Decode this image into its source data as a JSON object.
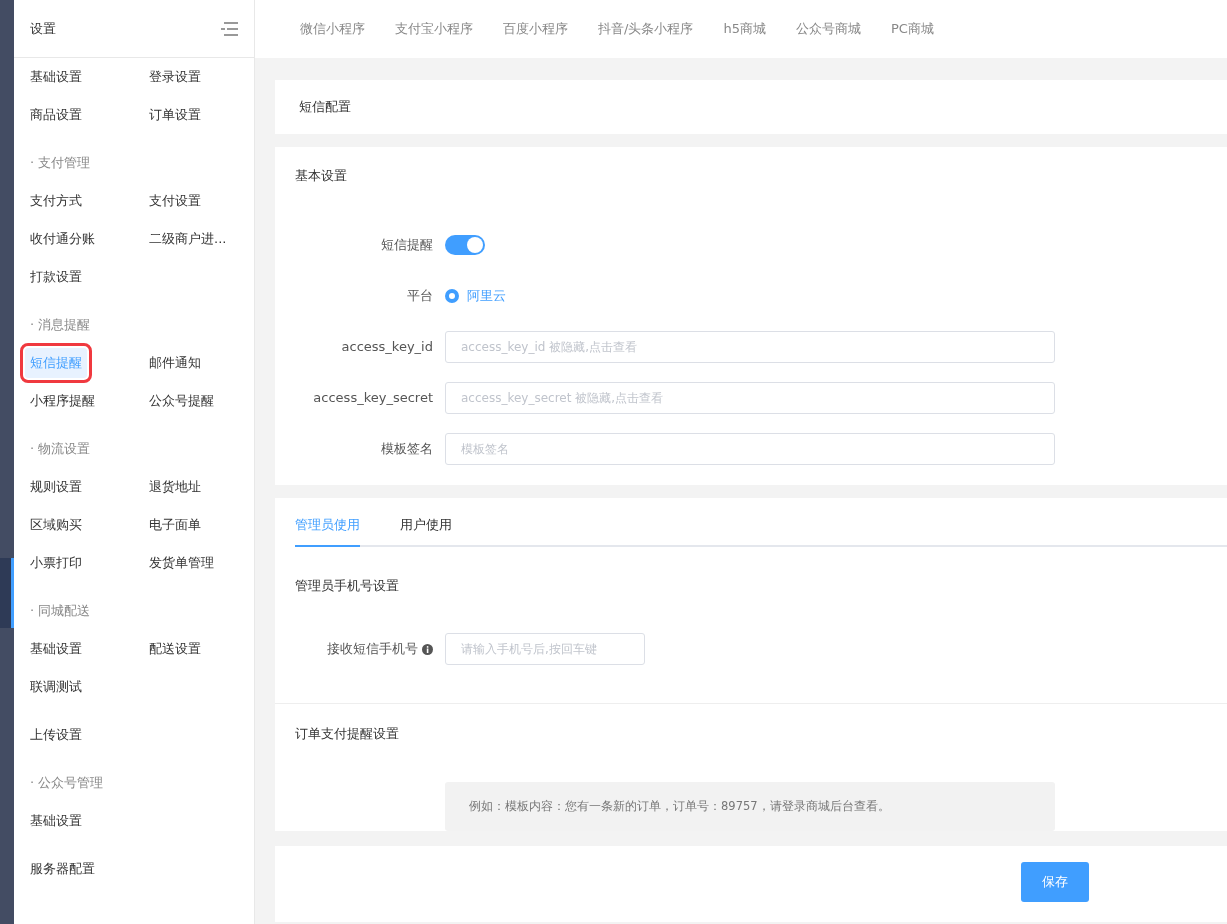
{
  "sidebar": {
    "title": "设置",
    "groups": [
      {
        "items": [
          {
            "label": "基础设置",
            "selected": false
          },
          {
            "label": "登录设置",
            "selected": false
          },
          {
            "label": "商品设置",
            "selected": false
          },
          {
            "label": "订单设置",
            "selected": false
          }
        ]
      },
      {
        "heading": "· 支付管理",
        "items": [
          {
            "label": "支付方式",
            "selected": false
          },
          {
            "label": "支付设置",
            "selected": false
          },
          {
            "label": "收付通分账",
            "selected": false
          },
          {
            "label": "二级商户进...",
            "selected": false
          },
          {
            "label": "打款设置",
            "selected": false
          }
        ]
      },
      {
        "heading": "· 消息提醒",
        "items": [
          {
            "label": "短信提醒",
            "selected": true
          },
          {
            "label": "邮件通知",
            "selected": false
          },
          {
            "label": "小程序提醒",
            "selected": false
          },
          {
            "label": "公众号提醒",
            "selected": false
          }
        ]
      },
      {
        "heading": "· 物流设置",
        "items": [
          {
            "label": "规则设置",
            "selected": false
          },
          {
            "label": "退货地址",
            "selected": false
          },
          {
            "label": "区域购买",
            "selected": false
          },
          {
            "label": "电子面单",
            "selected": false
          },
          {
            "label": "小票打印",
            "selected": false
          },
          {
            "label": "发货单管理",
            "selected": false
          }
        ]
      },
      {
        "heading": "· 同城配送",
        "items": [
          {
            "label": "基础设置",
            "selected": false
          },
          {
            "label": "配送设置",
            "selected": false
          },
          {
            "label": "联调测试",
            "selected": false
          }
        ]
      },
      {
        "items": [
          {
            "label": "上传设置",
            "selected": false
          }
        ]
      },
      {
        "heading": "· 公众号管理",
        "items": [
          {
            "label": "基础设置",
            "selected": false
          }
        ]
      },
      {
        "items": [
          {
            "label": "服务器配置",
            "selected": false
          }
        ]
      }
    ]
  },
  "top_tabs": [
    "微信小程序",
    "支付宝小程序",
    "百度小程序",
    "抖音/头条小程序",
    "h5商城",
    "公众号商城",
    "PC商城"
  ],
  "page_title": "短信配置",
  "basic": {
    "title": "基本设置",
    "fields": [
      {
        "kind": "switch",
        "label": "短信提醒",
        "on": true
      },
      {
        "kind": "radio",
        "label": "平台",
        "options": [
          {
            "label": "阿里云",
            "selected": true
          }
        ]
      },
      {
        "kind": "input",
        "label": "access_key_id",
        "placeholder": "access_key_id 被隐藏,点击查看"
      },
      {
        "kind": "input",
        "label": "access_key_secret",
        "placeholder": "access_key_secret 被隐藏,点击查看"
      },
      {
        "kind": "input",
        "label": "模板签名",
        "placeholder": "模板签名"
      }
    ]
  },
  "usage_tabs": [
    {
      "label": "管理员使用",
      "selected": true
    },
    {
      "label": "用户使用",
      "selected": false
    }
  ],
  "admin_phone": {
    "title": "管理员手机号设置",
    "label": "接收短信手机号",
    "placeholder": "请输入手机号后,按回车键"
  },
  "order_payment": {
    "title": "订单支付提醒设置",
    "example": "例如：模板内容：您有一条新的订单，订单号：89757，请登录商城后台查看。"
  },
  "save_button": "保存"
}
